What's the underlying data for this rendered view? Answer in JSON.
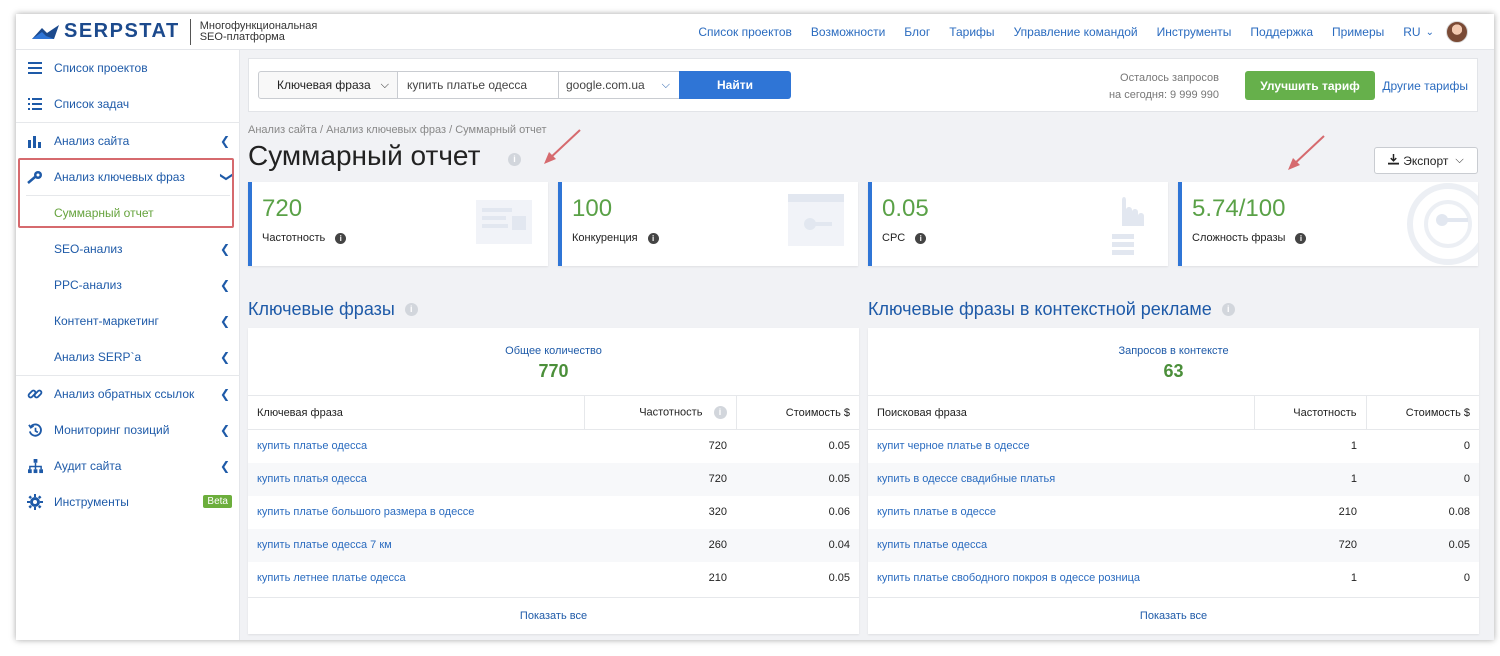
{
  "header": {
    "logo_text": "SERPSTAT",
    "logo_subtitle": "Многофункциональная SEO-платформа",
    "nav": [
      "Список проектов",
      "Возможности",
      "Блог",
      "Тарифы",
      "Управление командой",
      "Инструменты",
      "Поддержка",
      "Примеры"
    ],
    "lang": "RU"
  },
  "sidebar": {
    "items": [
      {
        "label": "Список проектов",
        "icon": "menu-icon"
      },
      {
        "label": "Список задач",
        "icon": "list-icon"
      },
      {
        "label": "Анализ сайта",
        "icon": "chart-icon"
      },
      {
        "label": "Анализ ключевых фраз",
        "icon": "key-icon"
      },
      {
        "label": "Суммарный отчет",
        "icon": ""
      },
      {
        "label": "SEO-анализ",
        "icon": ""
      },
      {
        "label": "PPC-анализ",
        "icon": ""
      },
      {
        "label": "Контент-маркетинг",
        "icon": ""
      },
      {
        "label": "Анализ SERP`а",
        "icon": ""
      },
      {
        "label": "Анализ обратных ссылок",
        "icon": "link-icon"
      },
      {
        "label": "Мониторинг позиций",
        "icon": "history-icon"
      },
      {
        "label": "Аудит сайта",
        "icon": "sitemap-icon"
      },
      {
        "label": "Инструменты",
        "icon": "gear-icon"
      }
    ],
    "beta_label": "Beta"
  },
  "search": {
    "type_label": "Ключевая фраза",
    "query": "купить платье одесса",
    "engine": "google.com.ua",
    "find_label": "Найти",
    "quota_line1": "Осталось запросов",
    "quota_line2": "на сегодня: 9 999 990",
    "upgrade_label": "Улучшить тариф",
    "other_tariffs_label": "Другие тарифы"
  },
  "breadcrumb": "Анализ сайта / Анализ ключевых фраз / Суммарный отчет",
  "page_title": "Суммарный отчет",
  "export_label": "Экспорт",
  "kpis": [
    {
      "value": "720",
      "label": "Частотность"
    },
    {
      "value": "100",
      "label": "Конкуренция"
    },
    {
      "value": "0.05",
      "label": "CPC"
    },
    {
      "value": "5.74",
      "value_suffix": "/100",
      "label": "Сложность фразы"
    }
  ],
  "keywords_panel": {
    "title": "Ключевые фразы",
    "total_label": "Общее количество",
    "total_value": "770",
    "columns": [
      "Ключевая фраза",
      "Частотность",
      "Стоимость $"
    ],
    "rows": [
      [
        "купить платье одесса",
        "720",
        "0.05"
      ],
      [
        "купить платья одесса",
        "720",
        "0.05"
      ],
      [
        "купить платье большого размера в одессе",
        "320",
        "0.06"
      ],
      [
        "купить платье одесса 7 км",
        "260",
        "0.04"
      ],
      [
        "купить летнее платье одесса",
        "210",
        "0.05"
      ]
    ],
    "show_all": "Показать все"
  },
  "ads_panel": {
    "title": "Ключевые фразы в контекстной рекламе",
    "total_label": "Запросов в контексте",
    "total_value": "63",
    "columns": [
      "Поисковая фраза",
      "Частотность",
      "Стоимость $"
    ],
    "rows": [
      [
        "купит черное платье в одессе",
        "1",
        "0"
      ],
      [
        "купить в одессе свадибные платья",
        "1",
        "0"
      ],
      [
        "купить платье в одессе",
        "210",
        "0.08"
      ],
      [
        "купить платье одесса",
        "720",
        "0.05"
      ],
      [
        "купить платье свободного покроя в одессе розница",
        "1",
        "0"
      ]
    ],
    "show_all": "Показать все"
  },
  "colors": {
    "brand": "#1c4a8d",
    "link": "#2a6bbf",
    "accent_blue": "#2f75d6",
    "green": "#5aa147",
    "highlight_red": "#d66a6e"
  }
}
